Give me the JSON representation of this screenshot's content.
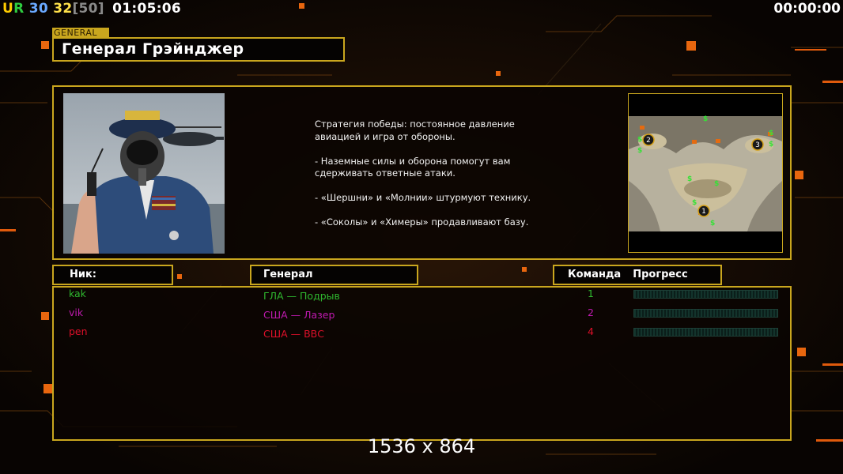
{
  "hud": {
    "stat_ur": "UR",
    "stat_1": "30",
    "stat_2": "32",
    "stat_3": "[50]",
    "clock_left": "01:05:06",
    "clock_right": "00:00:00"
  },
  "general": {
    "tag": "GENERAL",
    "name": "Генерал Грэйнджер",
    "description": "Стратегия победы: постоянное давление\n авиацией и игра от обороны.\n\n- Наземные силы и оборона помогут вам\n сдерживать ответные атаки.\n\n- «Шершни» и «Молнии» штурмуют технику.\n\n- «Соколы» и «Химеры» продавливают базу."
  },
  "minimap": {
    "markers": [
      "1",
      "2",
      "3"
    ],
    "icon": "supply-dollar-icon"
  },
  "table": {
    "col_nick": "Ник:",
    "col_general": "Генерал",
    "col_team": "Команда",
    "col_progress": "Прогресс",
    "rows": [
      {
        "nick": "kak",
        "general": "ГЛА — Подрыв",
        "team": "1",
        "color": "#2fb82f",
        "progress": 0
      },
      {
        "nick": "vik",
        "general": "США — Лазер",
        "team": "2",
        "color": "#c01ab0",
        "progress": 0
      },
      {
        "nick": "pen",
        "general": "США — ВВС",
        "team": "4",
        "color": "#e0102a",
        "progress": 0
      }
    ]
  },
  "resolution": "1536 x 864",
  "colors": {
    "frame": "#c9a61e",
    "ur_u": "#ffcc00",
    "ur_r": "#2ecc40",
    "stat_1": "#6aa9ff",
    "stat_2": "#ffe14a",
    "stat_3": "#8a8a8a"
  }
}
